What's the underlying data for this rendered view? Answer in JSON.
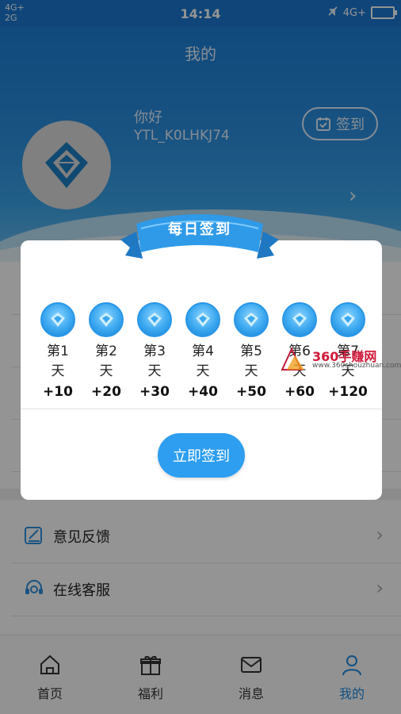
{
  "status_bar": {
    "network_top": "4G+",
    "network_bottom": "2G",
    "time": "14:14",
    "network_right": "4G+"
  },
  "header": {
    "title": "我的",
    "greeting": "你好",
    "username": "YTL_K0LHKJ74",
    "signin_label": "签到"
  },
  "menu": {
    "items": [
      {
        "label": "意见反馈",
        "icon": "feedback-icon"
      },
      {
        "label": "在线客服",
        "icon": "headset-icon"
      }
    ]
  },
  "tabbar": {
    "tabs": [
      {
        "label": "首页",
        "icon": "home-icon"
      },
      {
        "label": "福利",
        "icon": "gift-icon"
      },
      {
        "label": "消息",
        "icon": "mail-icon"
      },
      {
        "label": "我的",
        "icon": "person-icon",
        "active": true
      }
    ]
  },
  "dialog": {
    "banner_title": "每日签到",
    "days": [
      {
        "label": "第1",
        "unit": "天",
        "reward": "+10"
      },
      {
        "label": "第2",
        "unit": "天",
        "reward": "+20"
      },
      {
        "label": "第3",
        "unit": "天",
        "reward": "+30"
      },
      {
        "label": "第4",
        "unit": "天",
        "reward": "+40"
      },
      {
        "label": "第5",
        "unit": "天",
        "reward": "+50"
      },
      {
        "label": "第6",
        "unit": "天",
        "reward": "+60"
      },
      {
        "label": "第7",
        "unit": "天",
        "reward": "+120"
      }
    ],
    "button_label": "立即签到"
  },
  "watermark": {
    "main": "360手赚网",
    "sub": "www.360shouzhuan.com"
  },
  "colors": {
    "primary": "#2d9ef0",
    "header_top": "#1c7fd6",
    "active_tab": "#1d8ae0"
  }
}
